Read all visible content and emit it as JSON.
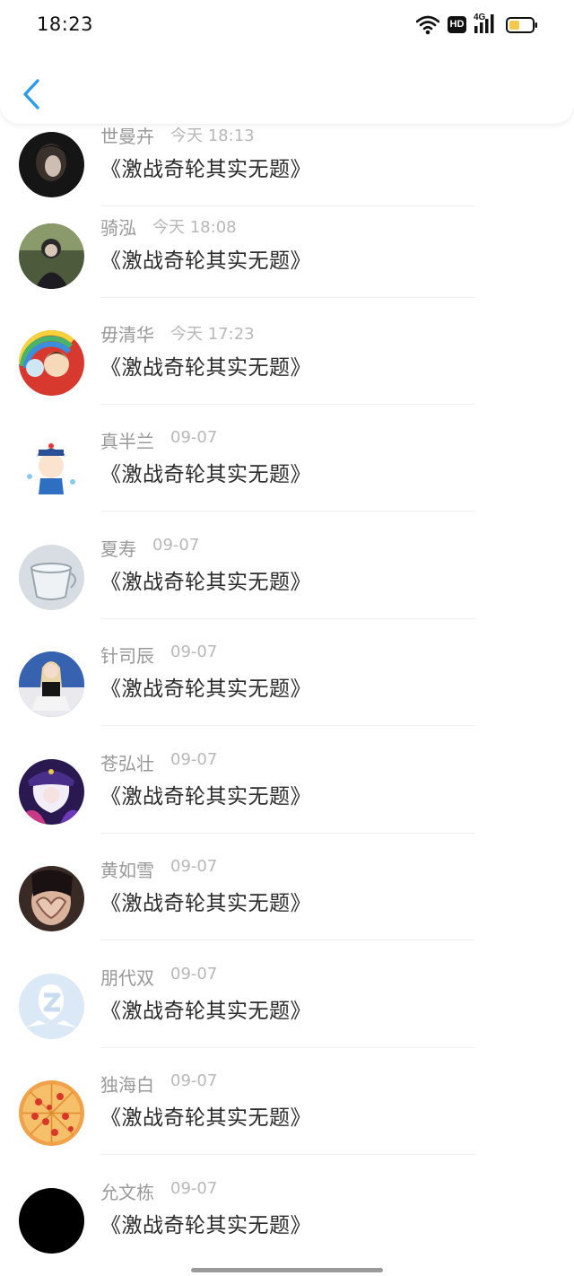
{
  "status_bar": {
    "time": "18:23",
    "icons": [
      "wifi-icon",
      "hd-icon",
      "4g-signal-icon",
      "battery-icon"
    ],
    "hd_label": "HD",
    "network_label": "4G"
  },
  "header": {
    "back_icon": "chevron-left-icon",
    "accent_color": "#2e9be6"
  },
  "comments": [
    {
      "name": "世曼卉",
      "time": "今天 18:13",
      "message": "《激战奇轮其实无题》"
    },
    {
      "name": "骑泓",
      "time": "今天 18:08",
      "message": "《激战奇轮其实无题》"
    },
    {
      "name": "毋清华",
      "time": "今天 17:23",
      "message": "《激战奇轮其实无题》"
    },
    {
      "name": "真半兰",
      "time": "09-07",
      "message": "《激战奇轮其实无题》"
    },
    {
      "name": "夏寿",
      "time": "09-07",
      "message": "《激战奇轮其实无题》"
    },
    {
      "name": "针司辰",
      "time": "09-07",
      "message": "《激战奇轮其实无题》"
    },
    {
      "name": "苍弘壮",
      "time": "09-07",
      "message": "《激战奇轮其实无题》"
    },
    {
      "name": "黄如雪",
      "time": "09-07",
      "message": "《激战奇轮其实无题》"
    },
    {
      "name": "朋代双",
      "time": "09-07",
      "message": "《激战奇轮其实无题》"
    },
    {
      "name": "独海白",
      "time": "09-07",
      "message": "《激战奇轮其实无题》"
    },
    {
      "name": "允文栋",
      "time": "09-07",
      "message": "《激战奇轮其实无题》"
    }
  ]
}
